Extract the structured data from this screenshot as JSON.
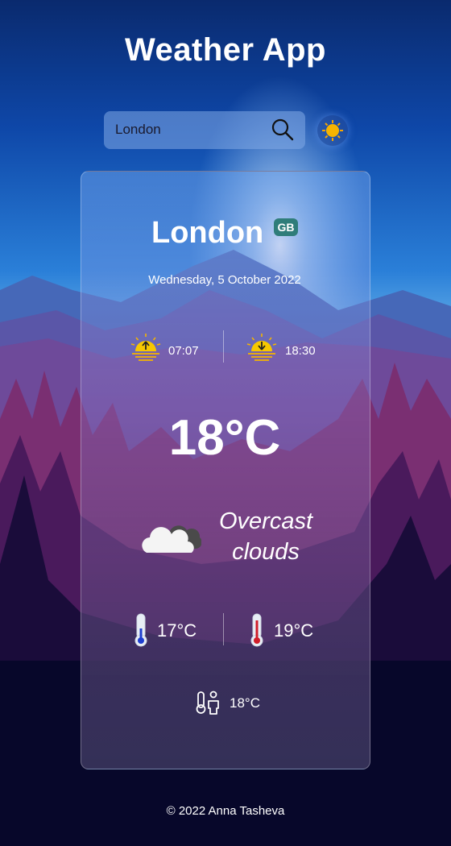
{
  "app": {
    "title": "Weather App"
  },
  "search": {
    "value": "London"
  },
  "weather": {
    "city": "London",
    "country": "GB",
    "date": "Wednesday, 5 October 2022",
    "sunrise": "07:07",
    "sunset": "18:30",
    "temperature": "18°C",
    "description_line1": "Overcast",
    "description_line2": "clouds",
    "temp_min": "17°C",
    "temp_max": "19°C",
    "feels_like": "18°C"
  },
  "footer": {
    "text": "© 2022 Anna Tasheva"
  },
  "icons": {
    "search": "search-icon",
    "theme": "sun-icon",
    "sunrise": "sunrise-icon",
    "sunset": "sunset-icon",
    "weather": "cloud-icon",
    "temp_min": "thermometer-low-icon",
    "temp_max": "thermometer-high-icon",
    "feels_like": "person-thermometer-icon"
  },
  "colors": {
    "accent_sun": "#f5c518",
    "country_badge": "#2f7d7a",
    "thermo_low": "#1e3fd0",
    "thermo_high": "#d01e2a"
  }
}
